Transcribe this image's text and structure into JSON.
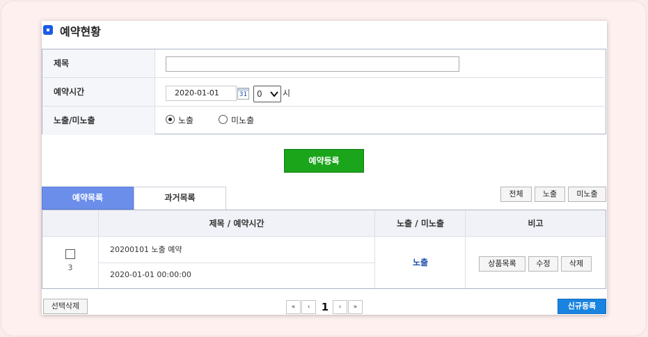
{
  "page": {
    "title": "예약현황"
  },
  "form": {
    "title_label": "제목",
    "title_value": "",
    "time_label": "예약시간",
    "date_value": "2020-01-01",
    "calendar_text": "31",
    "hour_value": "0",
    "hour_unit": "시",
    "expose_label": "노출/미노출",
    "radio_expose": "노출",
    "radio_hide": "미노출",
    "selected_radio": "노출"
  },
  "register_button": "예약등록",
  "tabs": {
    "active": "예약목록",
    "inactive": "과거목록"
  },
  "filters": {
    "all": "전체",
    "expose": "노출",
    "hide": "미노출"
  },
  "table": {
    "headers": {
      "title_time": "제목 / 예약시간",
      "expose": "노출 / 미노출",
      "note": "비고"
    },
    "rows": [
      {
        "number": "3",
        "title": "20200101 노출 예약",
        "time": "2020-01-01 00:00:00",
        "status": "노출",
        "actions": {
          "product_list": "상품목록",
          "edit": "수정",
          "delete": "삭제"
        }
      }
    ]
  },
  "bottom": {
    "delete_selected": "선택삭제",
    "pagination": {
      "first": "«",
      "prev": "‹",
      "current": "1",
      "next": "›",
      "last": "»"
    },
    "new_button": "신규등록"
  },
  "colors": {
    "accent": "#1b5be6",
    "register": "#1aa51a",
    "tab_active": "#6b8eea",
    "new_button": "#1a83e0",
    "link": "#1e4fae"
  }
}
